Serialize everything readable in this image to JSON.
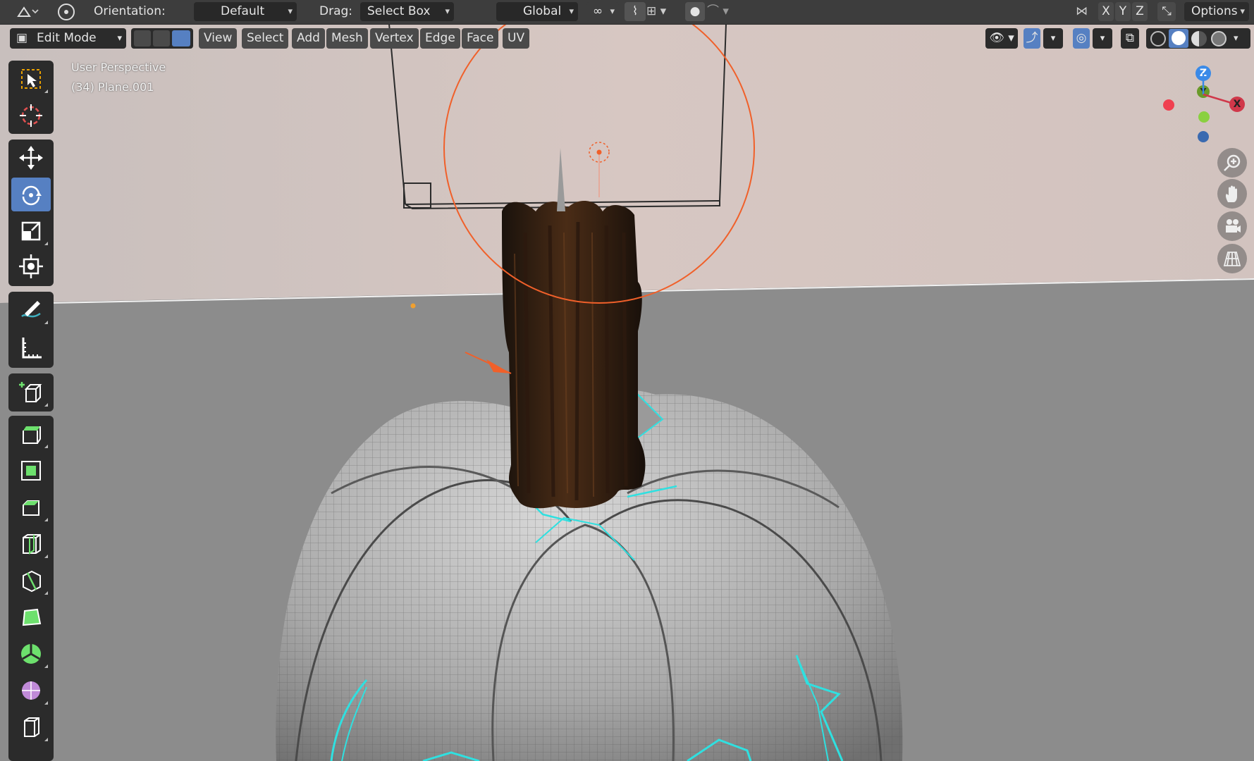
{
  "topbar": {
    "orientation_label": "Orientation:",
    "orientation_value": "Default",
    "drag_label": "Drag:",
    "drag_value": "Select Box",
    "transform_space": "Global",
    "axis_x": "X",
    "axis_y": "Y",
    "axis_z": "Z",
    "options": "Options"
  },
  "header": {
    "mode": "Edit Mode",
    "menus": [
      "View",
      "Select",
      "Add",
      "Mesh",
      "Vertex",
      "Edge",
      "Face",
      "UV"
    ]
  },
  "viewport": {
    "perspective": "User Perspective",
    "object_info": "(34) Plane.001"
  },
  "gizmo": {
    "z": "Z",
    "y": "Y",
    "x": "X"
  },
  "colors": {
    "accent": "#5680c2",
    "selection_cyan": "#2fe0e0",
    "orange": "#f0602a",
    "wall": "#cbbcb8",
    "floor": "#8c8c8c"
  },
  "tools": [
    "select-box-icon",
    "cursor-icon",
    "move-icon",
    "rotate-icon",
    "scale-icon",
    "transform-icon",
    "annotate-icon",
    "measure-icon",
    "add-cube-icon",
    "extrude-icon",
    "inset-icon",
    "bevel-icon",
    "loop-cut-icon",
    "knife-icon",
    "poly-build-icon",
    "spin-icon",
    "smooth-icon",
    "edge-slide-icon"
  ],
  "active_tool": "rotate-icon"
}
